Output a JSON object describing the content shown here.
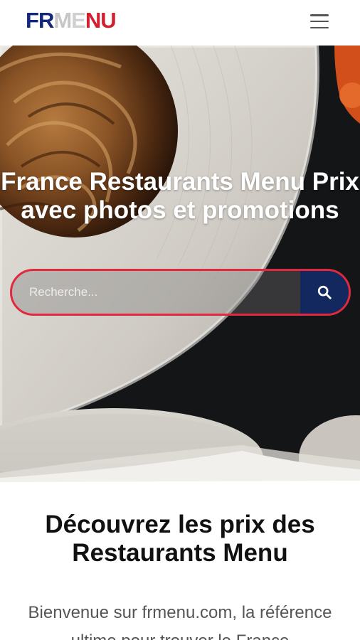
{
  "header": {
    "logo_letters": [
      {
        "char": "F",
        "color": "#13287a"
      },
      {
        "char": "R",
        "color": "#13287a"
      },
      {
        "char": "M",
        "color": "#c7c7c7"
      },
      {
        "char": "E",
        "color": "#d0d0d0"
      },
      {
        "char": "N",
        "color": "#d3202f"
      },
      {
        "char": "U",
        "color": "#d3202f"
      }
    ],
    "menu_icon": "hamburger-icon"
  },
  "hero": {
    "title": "France Restaurants Menu Prix avec photos et promotions",
    "search": {
      "placeholder": "Recherche...",
      "button_icon": "search-icon"
    }
  },
  "section": {
    "title": "Découvrez les prix des Restaurants Menu",
    "intro": "Bienvenue sur frmenu.com, la référence ultime pour trouver le France"
  },
  "colors": {
    "accent_red": "#e0293e",
    "navy": "#13285e",
    "logo_blue": "#13287a",
    "logo_red": "#d3202f"
  }
}
